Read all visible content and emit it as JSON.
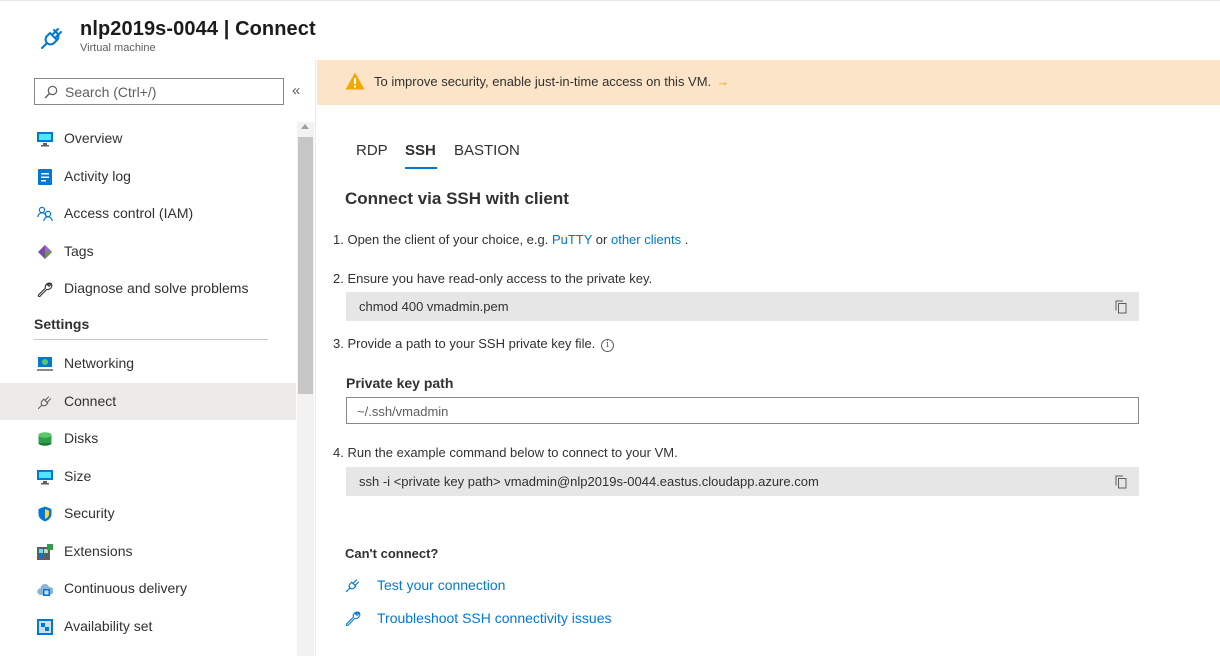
{
  "header": {
    "title": "nlp2019s-0044 | Connect",
    "subtitle": "Virtual machine"
  },
  "sidebar": {
    "search_placeholder": "Search (Ctrl+/)",
    "collapse_glyph": "«",
    "items": [
      {
        "label": "Overview",
        "icon": "monitor-icon"
      },
      {
        "label": "Activity log",
        "icon": "activity-log-icon"
      },
      {
        "label": "Access control (IAM)",
        "icon": "people-icon"
      },
      {
        "label": "Tags",
        "icon": "tag-icon"
      },
      {
        "label": "Diagnose and solve problems",
        "icon": "wrench-icon"
      }
    ],
    "section_settings": "Settings",
    "settings_items": [
      {
        "label": "Networking",
        "icon": "network-icon"
      },
      {
        "label": "Connect",
        "icon": "plug-icon",
        "active": true
      },
      {
        "label": "Disks",
        "icon": "disk-icon"
      },
      {
        "label": "Size",
        "icon": "monitor-icon"
      },
      {
        "label": "Security",
        "icon": "shield-icon"
      },
      {
        "label": "Extensions",
        "icon": "extensions-icon"
      },
      {
        "label": "Continuous delivery",
        "icon": "cloud-delivery-icon"
      },
      {
        "label": "Availability set",
        "icon": "availability-set-icon"
      }
    ]
  },
  "banner": {
    "text": "To improve security, enable just-in-time access on this VM.",
    "arrow": "→"
  },
  "tabs": [
    {
      "label": "RDP"
    },
    {
      "label": "SSH",
      "selected": true
    },
    {
      "label": "BASTION"
    }
  ],
  "main": {
    "heading": "Connect via SSH with client",
    "step1_prefix": "1. Open the client of your choice, e.g. ",
    "step1_link1": "PuTTY",
    "step1_mid": " or ",
    "step1_link2": "other clients",
    "step1_suffix": " .",
    "step2": "2. Ensure you have read-only access to the private key.",
    "code1": "chmod 400 vmadmin.pem",
    "step3": "3. Provide a path to your SSH private key file.",
    "info_glyph": "i",
    "field_label": "Private key path",
    "field_placeholder": "~/.ssh/vmadmin",
    "step4": "4. Run the example command below to connect to your VM.",
    "code2": "ssh -i <private key path> vmadmin@nlp2019s-0044.eastus.cloudapp.azure.com",
    "cant_connect": "Can't connect?",
    "link_test": "Test your connection",
    "link_troubleshoot": "Troubleshoot SSH connectivity issues"
  },
  "colors": {
    "accent": "#0078d4",
    "banner_bg": "#fce4c8",
    "warning": "#f2a800",
    "active_nav_bg": "#edebe9"
  }
}
